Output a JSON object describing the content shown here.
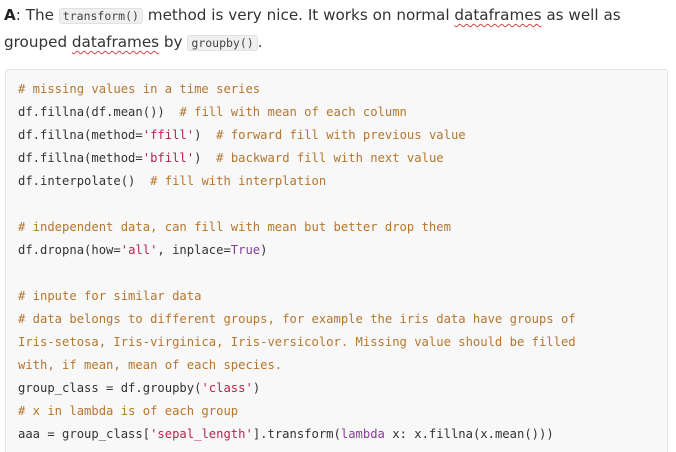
{
  "answer": {
    "label": "A",
    "text_1": ": The ",
    "code_1": "transform()",
    "text_2": " method is very nice. It works on normal ",
    "word_1": "dataframes",
    "text_3": " as well as grouped ",
    "word_2": "dataframes",
    "text_4": " by ",
    "code_2": "groupby()",
    "text_5": "."
  },
  "code": {
    "l1": "# missing values in a time series",
    "l2_code": "df.fillna(df.mean())",
    "l2_comment": "# fill with mean of each column",
    "l3_pre": "df.fillna(method=",
    "l3_str": "'ffill'",
    "l3_post": ")",
    "l3_comment": "# forward fill with previous value",
    "l4_pre": "df.fillna(method=",
    "l4_str": "'bfill'",
    "l4_post": ")",
    "l4_comment": "# backward fill with next value",
    "l5_code": "df.interpolate()",
    "l5_comment": "# fill with interplation",
    "l7": "# independent data, can fill with mean but better drop them",
    "l8_pre": "df.dropna(how=",
    "l8_str": "'all'",
    "l8_mid": ", inplace=",
    "l8_kw": "True",
    "l8_post": ")",
    "l10": "# inpute for similar data",
    "l11": "# data belongs to different groups, for example the iris data have groups of",
    "l12": "Iris-setosa, Iris-virginica, Iris-versicolor. Missing value should be filled",
    "l13": "with, if mean, mean of each species.",
    "l14_pre": "group_class = df.groupby(",
    "l14_str": "'class'",
    "l14_post": ")",
    "l15": "# x in lambda is of each group",
    "l16_pre": "aaa = group_class[",
    "l16_str": "'sepal_length'",
    "l16_mid": "].transform(",
    "l16_kw": "lambda",
    "l16_post": " x: x.fillna(x.mean()))"
  }
}
